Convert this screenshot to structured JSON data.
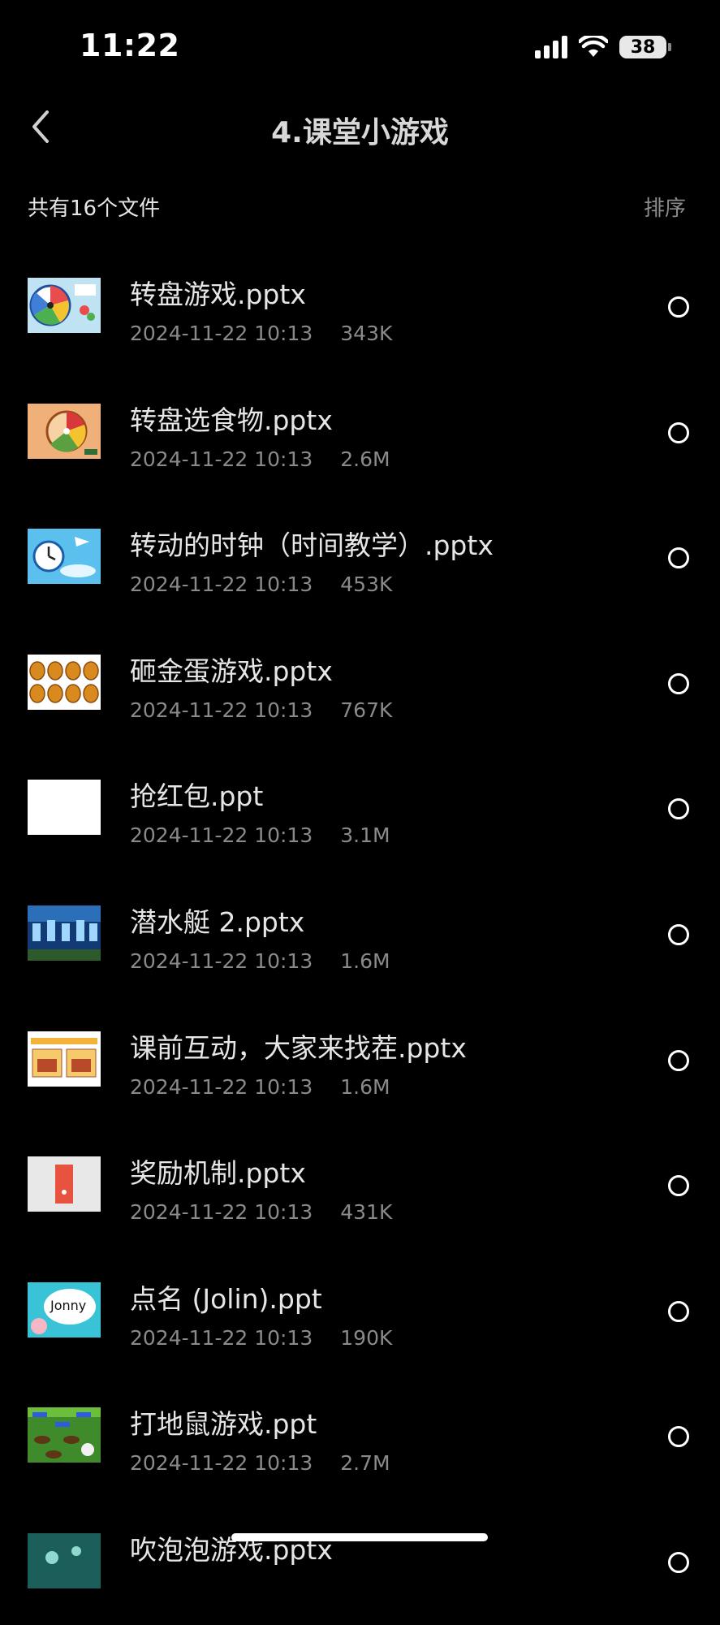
{
  "status_bar": {
    "time": "11:22",
    "battery_level": "38",
    "icons": [
      "cellular-signal-icon",
      "wifi-icon",
      "battery-icon"
    ]
  },
  "nav": {
    "title": "4.课堂小游戏",
    "back_icon": "chevron-left-icon"
  },
  "list_header": {
    "count_label": "共有16个文件",
    "sort_label": "排序"
  },
  "files": [
    {
      "name": "转盘游戏.pptx",
      "date": "2024-11-22 10:13",
      "size": "343K",
      "thumb": "spinning-wheel-thumbnail"
    },
    {
      "name": "转盘选食物.pptx",
      "date": "2024-11-22 10:13",
      "size": "2.6M",
      "thumb": "food-wheel-thumbnail"
    },
    {
      "name": "转动的时钟（时间教学）.pptx",
      "date": "2024-11-22 10:13",
      "size": "453K",
      "thumb": "clock-thumbnail"
    },
    {
      "name": "砸金蛋游戏.pptx",
      "date": "2024-11-22 10:13",
      "size": "767K",
      "thumb": "golden-eggs-thumbnail"
    },
    {
      "name": "抢红包.ppt",
      "date": "2024-11-22 10:13",
      "size": "3.1M",
      "thumb": "blank-white-thumbnail"
    },
    {
      "name": "潜水艇 2.pptx",
      "date": "2024-11-22 10:13",
      "size": "1.6M",
      "thumb": "submarine-thumbnail"
    },
    {
      "name": "课前互动，大家来找茬.pptx",
      "date": "2024-11-22 10:13",
      "size": "1.6M",
      "thumb": "spot-difference-thumbnail"
    },
    {
      "name": "奖励机制.pptx",
      "date": "2024-11-22 10:13",
      "size": "431K",
      "thumb": "reward-thumbnail"
    },
    {
      "name": "点名 (Jolin).ppt",
      "date": "2024-11-22 10:13",
      "size": "190K",
      "thumb": "roll-call-thumbnail",
      "thumb_text": "Jonny"
    },
    {
      "name": "打地鼠游戏.ppt",
      "date": "2024-11-22 10:13",
      "size": "2.7M",
      "thumb": "whack-a-mole-thumbnail"
    },
    {
      "name": "吹泡泡游戏.pptx",
      "date": "",
      "size": "",
      "thumb": "bubbles-thumbnail"
    }
  ],
  "colors": {
    "background": "#000000",
    "primary_text": "#e6e6e6",
    "secondary_text": "#8a8a8a",
    "title_text": "#d8d8d8"
  }
}
